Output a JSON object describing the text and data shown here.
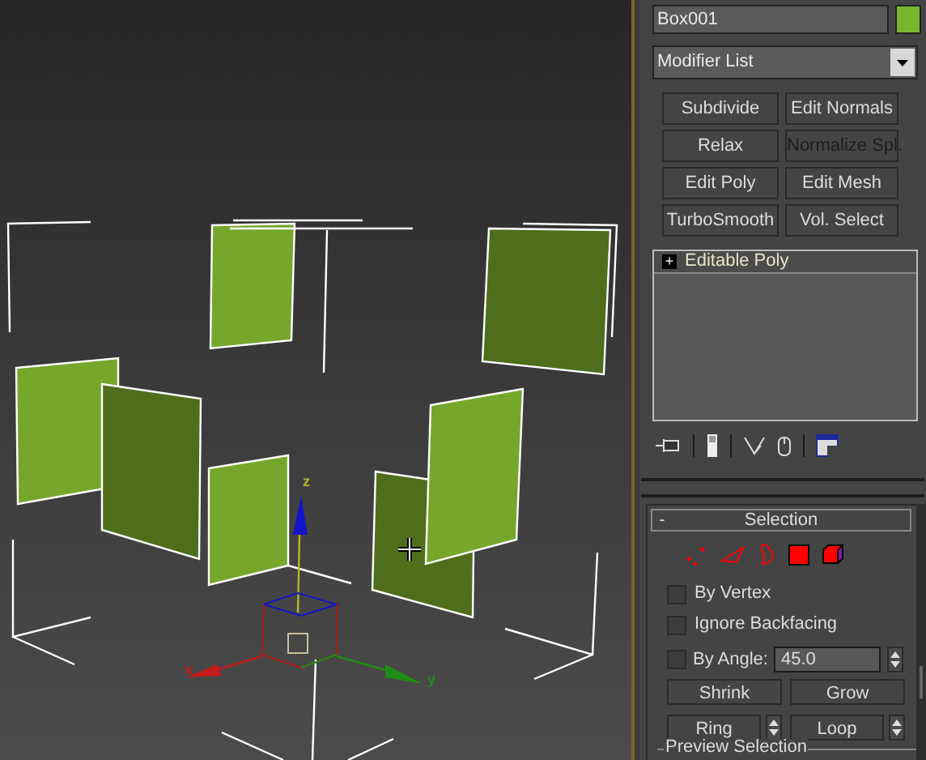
{
  "viewport": {
    "gizmo_axes": [
      {
        "label": "x",
        "color": "#c41a1a"
      },
      {
        "label": "y",
        "color": "#1e8c14"
      },
      {
        "label": "z",
        "color": "#b5b52a"
      }
    ]
  },
  "command_panel": {
    "object_name": "Box001",
    "modifier_list": "Modifier List",
    "modifier_buttons": [
      {
        "label": "Subdivide",
        "disabled": false
      },
      {
        "label": "Edit Normals",
        "disabled": false
      },
      {
        "label": "Relax",
        "disabled": false
      },
      {
        "label": "Normalize Spl.",
        "disabled": true
      },
      {
        "label": "Edit Poly",
        "disabled": false
      },
      {
        "label": "Edit Mesh",
        "disabled": false
      },
      {
        "label": "TurboSmooth",
        "disabled": false
      },
      {
        "label": "Vol. Select",
        "disabled": false
      }
    ],
    "stack": [
      {
        "label": "Editable Poly",
        "expand_sign": "+"
      }
    ],
    "selection_rollout": {
      "title": "Selection",
      "collapse_sign": "-",
      "options": [
        {
          "label": "By Vertex",
          "checked": false
        },
        {
          "label": "Ignore Backfacing",
          "checked": false
        },
        {
          "label": "By Angle:",
          "checked": false,
          "value": "45.0"
        }
      ],
      "buttons": [
        {
          "label": "Shrink",
          "spinner": false
        },
        {
          "label": "Grow",
          "spinner": false
        },
        {
          "label": "Ring",
          "spinner": true
        },
        {
          "label": "Loop",
          "spinner": true
        }
      ],
      "group_label": "Preview Selection"
    }
  }
}
